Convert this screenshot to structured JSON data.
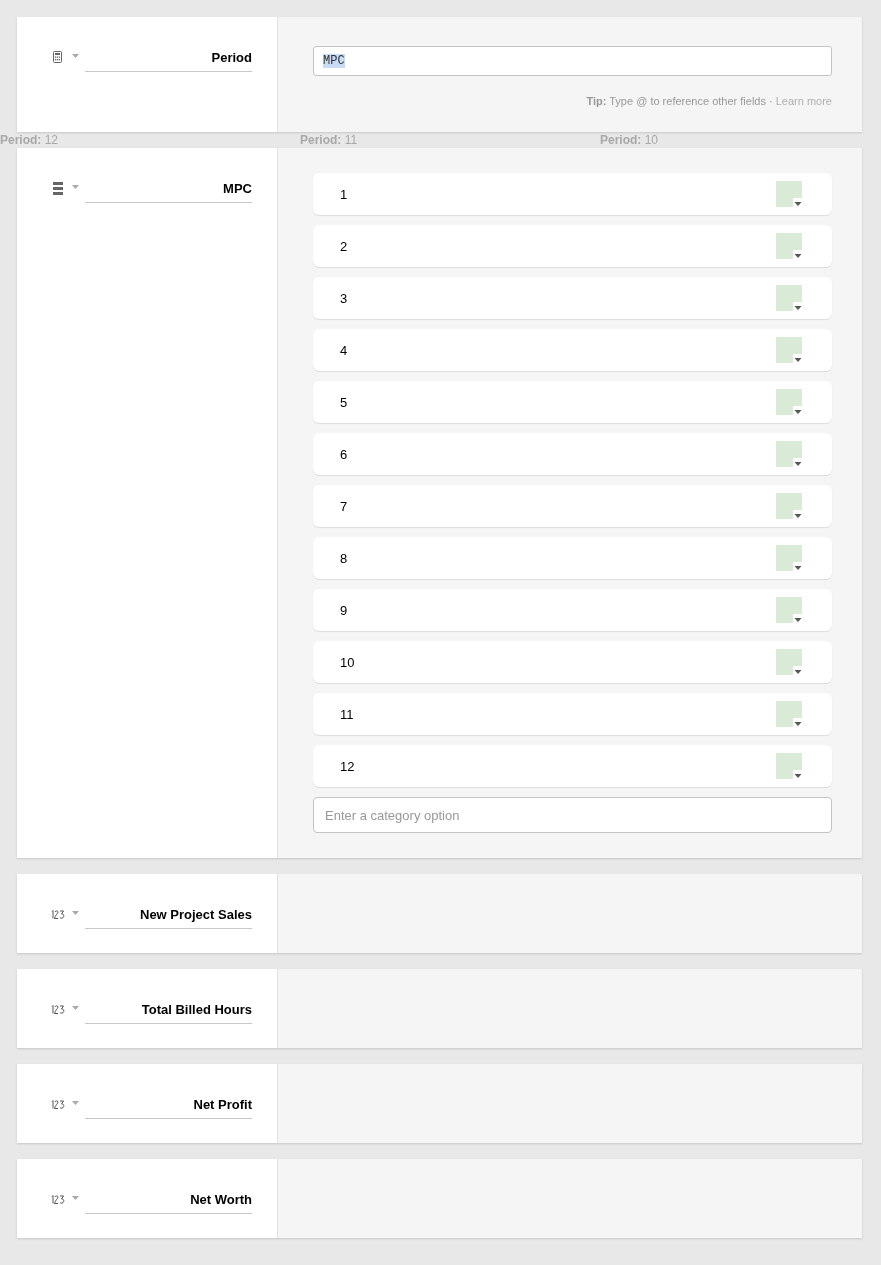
{
  "fields": [
    {
      "kind": "formula",
      "name": "Period",
      "formula": {
        "value": "MPC",
        "tip_label": "Tip:",
        "tip_text": "Type @ to reference other fields ·",
        "tip_link": "Learn more"
      }
    },
    {
      "kind": "category",
      "name": "MPC",
      "options": [
        {
          "label": "1",
          "color": "#d9ead6"
        },
        {
          "label": "2",
          "color": "#d9ead6"
        },
        {
          "label": "3",
          "color": "#d9ead6"
        },
        {
          "label": "4",
          "color": "#d9ead6"
        },
        {
          "label": "5",
          "color": "#d9ead6"
        },
        {
          "label": "6",
          "color": "#d9ead6"
        },
        {
          "label": "7",
          "color": "#d9ead6"
        },
        {
          "label": "8",
          "color": "#d9ead6"
        },
        {
          "label": "9",
          "color": "#d9ead6"
        },
        {
          "label": "10",
          "color": "#d9ead6"
        },
        {
          "label": "11",
          "color": "#d9ead6"
        },
        {
          "label": "12",
          "color": "#d9ead6"
        }
      ],
      "new_option_placeholder": "Enter a category option"
    },
    {
      "kind": "number",
      "name": "New Project Sales"
    },
    {
      "kind": "number",
      "name": "Total Billed Hours"
    },
    {
      "kind": "number",
      "name": "Net Profit"
    },
    {
      "kind": "number",
      "name": "Net Worth"
    }
  ],
  "background_labels": [
    {
      "label": "Period:",
      "value": "12"
    },
    {
      "label": "Period:",
      "value": "11"
    },
    {
      "label": "Period:",
      "value": "10"
    }
  ]
}
